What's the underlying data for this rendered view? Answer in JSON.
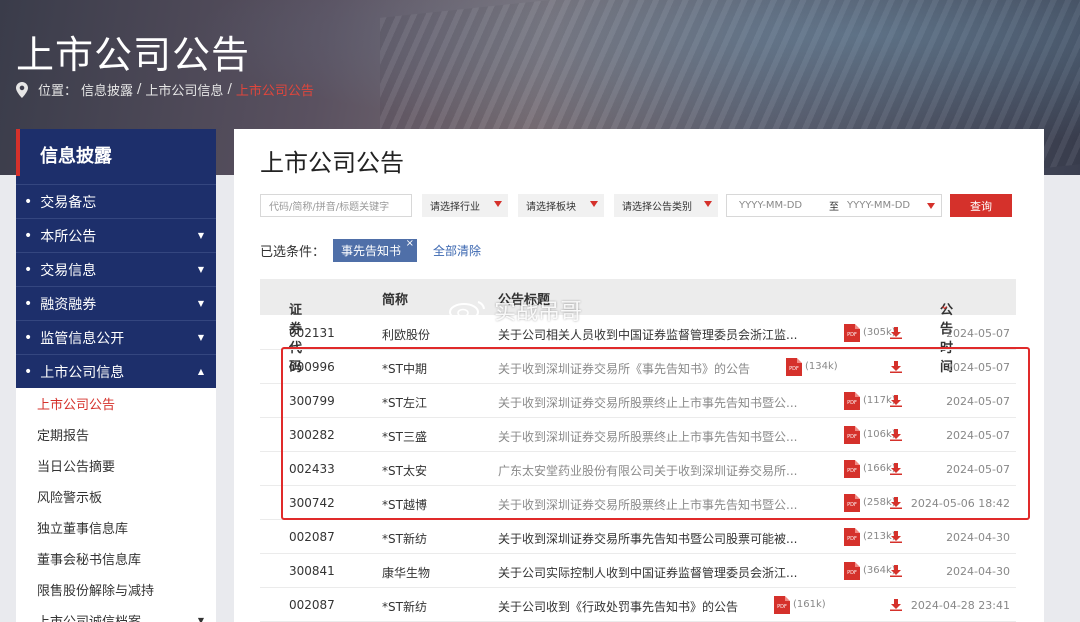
{
  "banner": {
    "title": "上市公司公告",
    "crumb_prefix": "位置：",
    "crumb_1": "信息披露",
    "crumb_sep1": "/",
    "crumb_2": "上市公司信息",
    "crumb_sep2": "/",
    "crumb_current": "上市公司公告"
  },
  "sidebar": {
    "header": "信息披露",
    "items": [
      {
        "label": "交易备忘",
        "arrow": ""
      },
      {
        "label": "本所公告",
        "arrow": "▼"
      },
      {
        "label": "交易信息",
        "arrow": "▼"
      },
      {
        "label": "融资融券",
        "arrow": "▼"
      },
      {
        "label": "监管信息公开",
        "arrow": "▼"
      },
      {
        "label": "上市公司信息",
        "arrow": "▲"
      }
    ],
    "sub_items": [
      {
        "label": "上市公司公告"
      },
      {
        "label": "定期报告"
      },
      {
        "label": "当日公告摘要"
      },
      {
        "label": "风险警示板"
      },
      {
        "label": "独立董事信息库"
      },
      {
        "label": "董事会秘书信息库"
      },
      {
        "label": "限售股份解除与减持"
      },
      {
        "label": "上市公司诚信档案"
      }
    ]
  },
  "panel": {
    "title": "上市公司公告",
    "search_placeholder": "代码/简称/拼音/标题关键字",
    "industry": "请选择行业",
    "board": "请选择板块",
    "category": "请选择公告类别",
    "date_from": "YYYY-MM-DD",
    "date_to_label": "至",
    "date_to": "YYYY-MM-DD",
    "query_btn": "查询",
    "cond_label": "已选条件：",
    "cond_tag": "事先告知书",
    "cond_tag_x": "×",
    "clear_all": "全部清除"
  },
  "table": {
    "headers": {
      "code": "证券代码",
      "name": "简称",
      "title": "公告标题",
      "time": "公告时间"
    },
    "rows": [
      {
        "code": "002131",
        "name": "利欧股份",
        "title": "关于公司相关人员收到中国证券监督管理委员会浙江监...",
        "size": "(305k)",
        "date": "2024-05-07"
      },
      {
        "code": "000996",
        "name": "*ST中期",
        "title": "关于收到深圳证券交易所《事先告知书》的公告",
        "size": "(134k)",
        "date": "2024-05-07"
      },
      {
        "code": "300799",
        "name": "*ST左江",
        "title": "关于收到深圳证券交易所股票终止上市事先告知书暨公...",
        "size": "(117k)",
        "date": "2024-05-07"
      },
      {
        "code": "300282",
        "name": "*ST三盛",
        "title": "关于收到深圳证券交易所股票终止上市事先告知书暨公...",
        "size": "(106k)",
        "date": "2024-05-07"
      },
      {
        "code": "002433",
        "name": "*ST太安",
        "title": "广东太安堂药业股份有限公司关于收到深圳证券交易所...",
        "size": "(166k)",
        "date": "2024-05-07"
      },
      {
        "code": "300742",
        "name": "*ST越博",
        "title": "关于收到深圳证券交易所股票终止上市事先告知书暨公...",
        "size": "(258k)",
        "date": "2024-05-06 18:42"
      },
      {
        "code": "002087",
        "name": "*ST新纺",
        "title": "关于收到深圳证券交易所事先告知书暨公司股票可能被...",
        "size": "(213k)",
        "date": "2024-04-30"
      },
      {
        "code": "300841",
        "name": "康华生物",
        "title": "关于公司实际控制人收到中国证券监督管理委员会浙江...",
        "size": "(364k)",
        "date": "2024-04-30"
      },
      {
        "code": "002087",
        "name": "*ST新纺",
        "title": "关于公司收到《行政处罚事先告知书》的公告",
        "size": "(161k)",
        "date": "2024-04-28 23:41"
      }
    ],
    "pdf_label": "PDF"
  },
  "watermark": "实战吊哥",
  "colors": {
    "navy": "#1d2f6b",
    "accent_red": "#d5312b",
    "tag_blue": "#4f6fa8"
  }
}
